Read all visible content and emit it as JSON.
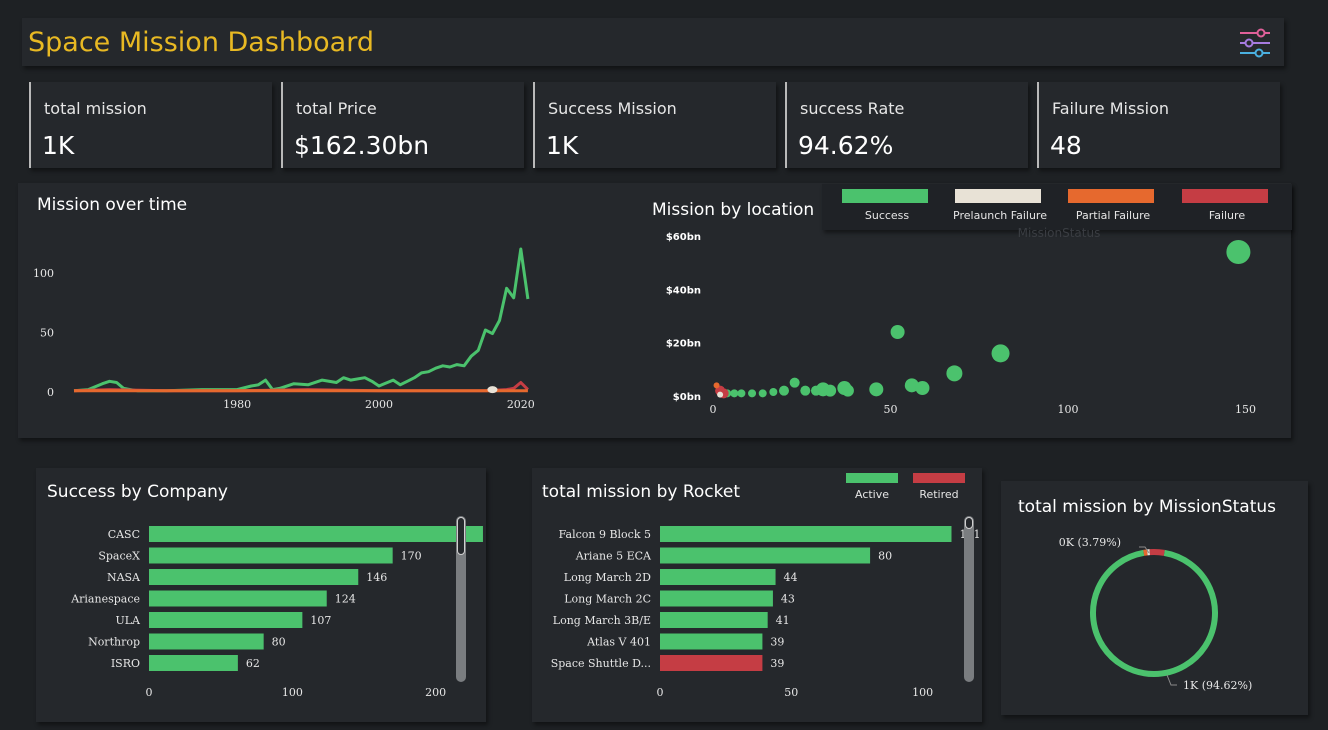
{
  "header": {
    "title": "Space Mission Dashboard",
    "filter_icon": "sliders-icon"
  },
  "kpis": [
    {
      "label": "total mission",
      "value": "1K"
    },
    {
      "label": "total Price",
      "value": "$162.30bn"
    },
    {
      "label": "Success Mission",
      "value": "1K"
    },
    {
      "label": "success Rate",
      "value": "94.62%"
    },
    {
      "label": "Failure Mission",
      "value": "48"
    }
  ],
  "colors": {
    "success": "#4bc26d",
    "prelaunch": "#e8e2d6",
    "partial": "#e6692e",
    "failure": "#c53d44",
    "accent": "#e8b923"
  },
  "legend": {
    "items": [
      "Success",
      "Prelaunch Failure",
      "Partial Failure",
      "Failure"
    ],
    "hidden_label": "MissionStatus"
  },
  "chart_data": [
    {
      "id": "mission_over_time",
      "type": "line",
      "title": "Mission over time",
      "xlim": [
        1957,
        2022
      ],
      "ylim": [
        0,
        125
      ],
      "x_ticks": [
        "1980",
        "2000",
        "2020"
      ],
      "y_ticks": [
        "0",
        "50",
        "100"
      ],
      "series": [
        {
          "name": "Success",
          "color": "#4bc26d",
          "x": [
            1957,
            1959,
            1961,
            1962,
            1963,
            1964,
            1966,
            1970,
            1975,
            1980,
            1982,
            1983,
            1984,
            1985,
            1986,
            1988,
            1990,
            1992,
            1994,
            1995,
            1996,
            1998,
            1999,
            2000,
            2002,
            2003,
            2004,
            2005,
            2006,
            2007,
            2008,
            2009,
            2010,
            2011,
            2012,
            2013,
            2014,
            2015,
            2016,
            2017,
            2018,
            2019,
            2020,
            2021
          ],
          "y": [
            1,
            2,
            7,
            9,
            8,
            3,
            1,
            1,
            2,
            2,
            5,
            6,
            10,
            2,
            3,
            7,
            6,
            10,
            8,
            12,
            10,
            12,
            9,
            5,
            10,
            6,
            9,
            12,
            16,
            17,
            20,
            22,
            21,
            23,
            22,
            30,
            35,
            52,
            49,
            60,
            87,
            79,
            120,
            78
          ]
        },
        {
          "name": "Failure",
          "color": "#c53d44",
          "x": [
            1957,
            1962,
            1970,
            1980,
            1990,
            2000,
            2010,
            2015,
            2018,
            2019,
            2020,
            2021
          ],
          "y": [
            1,
            2,
            1,
            1,
            2,
            1,
            1,
            1,
            2,
            3,
            8,
            2
          ]
        },
        {
          "name": "Partial Failure",
          "color": "#e6692e",
          "x": [
            1957,
            1965,
            1975,
            1985,
            1995,
            2005,
            2015,
            2021
          ],
          "y": [
            1,
            1,
            1,
            1,
            1,
            1,
            1,
            1
          ]
        },
        {
          "name": "Prelaunch Failure",
          "color": "#e8e2d6",
          "points": [
            {
              "x": 2016,
              "y": 2
            }
          ]
        }
      ]
    },
    {
      "id": "mission_by_location",
      "type": "scatter",
      "title": "Mission by location",
      "xlim": [
        0,
        160
      ],
      "ylim": [
        0,
        60
      ],
      "x_ticks": [
        "0",
        "50",
        "100",
        "150"
      ],
      "y_ticks": [
        "$0bn",
        "$20bn",
        "$40bn",
        "$60bn"
      ],
      "points": [
        {
          "x": 148,
          "y": 54,
          "r": 12,
          "color": "#4bc26d"
        },
        {
          "x": 52,
          "y": 24,
          "r": 7,
          "color": "#4bc26d"
        },
        {
          "x": 81,
          "y": 16,
          "r": 9,
          "color": "#4bc26d"
        },
        {
          "x": 68,
          "y": 8.5,
          "r": 8,
          "color": "#4bc26d"
        },
        {
          "x": 56,
          "y": 4,
          "r": 7,
          "color": "#4bc26d"
        },
        {
          "x": 59,
          "y": 3,
          "r": 7,
          "color": "#4bc26d"
        },
        {
          "x": 46,
          "y": 2.5,
          "r": 7,
          "color": "#4bc26d"
        },
        {
          "x": 37,
          "y": 3,
          "r": 7,
          "color": "#4bc26d"
        },
        {
          "x": 31,
          "y": 2.5,
          "r": 7,
          "color": "#4bc26d"
        },
        {
          "x": 23,
          "y": 5,
          "r": 5,
          "color": "#4bc26d"
        },
        {
          "x": 38,
          "y": 2,
          "r": 6,
          "color": "#4bc26d"
        },
        {
          "x": 33,
          "y": 2,
          "r": 6,
          "color": "#4bc26d"
        },
        {
          "x": 29,
          "y": 2,
          "r": 5,
          "color": "#4bc26d"
        },
        {
          "x": 26,
          "y": 2,
          "r": 5,
          "color": "#4bc26d"
        },
        {
          "x": 20,
          "y": 2,
          "r": 5,
          "color": "#4bc26d"
        },
        {
          "x": 17,
          "y": 1.5,
          "r": 4,
          "color": "#4bc26d"
        },
        {
          "x": 14,
          "y": 1,
          "r": 4,
          "color": "#4bc26d"
        },
        {
          "x": 11,
          "y": 1,
          "r": 4,
          "color": "#4bc26d"
        },
        {
          "x": 8,
          "y": 1,
          "r": 4,
          "color": "#4bc26d"
        },
        {
          "x": 6,
          "y": 1,
          "r": 4,
          "color": "#4bc26d"
        },
        {
          "x": 4,
          "y": 1,
          "r": 4,
          "color": "#4bc26d"
        },
        {
          "x": 2,
          "y": 2,
          "r": 5,
          "color": "#c53d44"
        },
        {
          "x": 3,
          "y": 1,
          "r": 5,
          "color": "#c53d44"
        },
        {
          "x": 1,
          "y": 4,
          "r": 3,
          "color": "#e6692e"
        },
        {
          "x": 2,
          "y": 0.5,
          "r": 3,
          "color": "#e8e2d6"
        }
      ]
    },
    {
      "id": "success_by_company",
      "type": "bar",
      "title": "Success by Company",
      "categories": [
        "CASC",
        "SpaceX",
        "NASA",
        "Arianespace",
        "ULA",
        "Northrop",
        "ISRO"
      ],
      "values": [
        233,
        170,
        146,
        124,
        107,
        80,
        62
      ],
      "xlim": [
        0,
        240
      ],
      "x_ticks": [
        "0",
        "100",
        "200"
      ],
      "color": "#4bc26d"
    },
    {
      "id": "mission_by_rocket",
      "type": "bar",
      "title": "total mission by Rocket",
      "categories": [
        "Falcon 9 Block 5",
        "Ariane 5 ECA",
        "Long March 2D",
        "Long March 2C",
        "Long March 3B/E",
        "Atlas V 401",
        "Space Shuttle D..."
      ],
      "values": [
        111,
        80,
        44,
        43,
        41,
        39,
        39
      ],
      "status": [
        "Active",
        "Active",
        "Active",
        "Active",
        "Active",
        "Active",
        "Retired"
      ],
      "legend": [
        "Active",
        "Retired"
      ],
      "xlim": [
        0,
        115
      ],
      "x_ticks": [
        "0",
        "50",
        "100"
      ],
      "colors": {
        "Active": "#4bc26d",
        "Retired": "#c53d44"
      }
    },
    {
      "id": "mission_by_status",
      "type": "pie",
      "title": "total mission by MissionStatus",
      "slices": [
        {
          "label": "1K (94.62%)",
          "value": 94.62,
          "color": "#4bc26d"
        },
        {
          "label": "0K (3.79%)",
          "value": 3.79,
          "color": "#c53d44"
        },
        {
          "label": "",
          "value": 0.94,
          "color": "#e6692e"
        },
        {
          "label": "",
          "value": 0.65,
          "color": "#e8e2d6"
        }
      ]
    }
  ]
}
